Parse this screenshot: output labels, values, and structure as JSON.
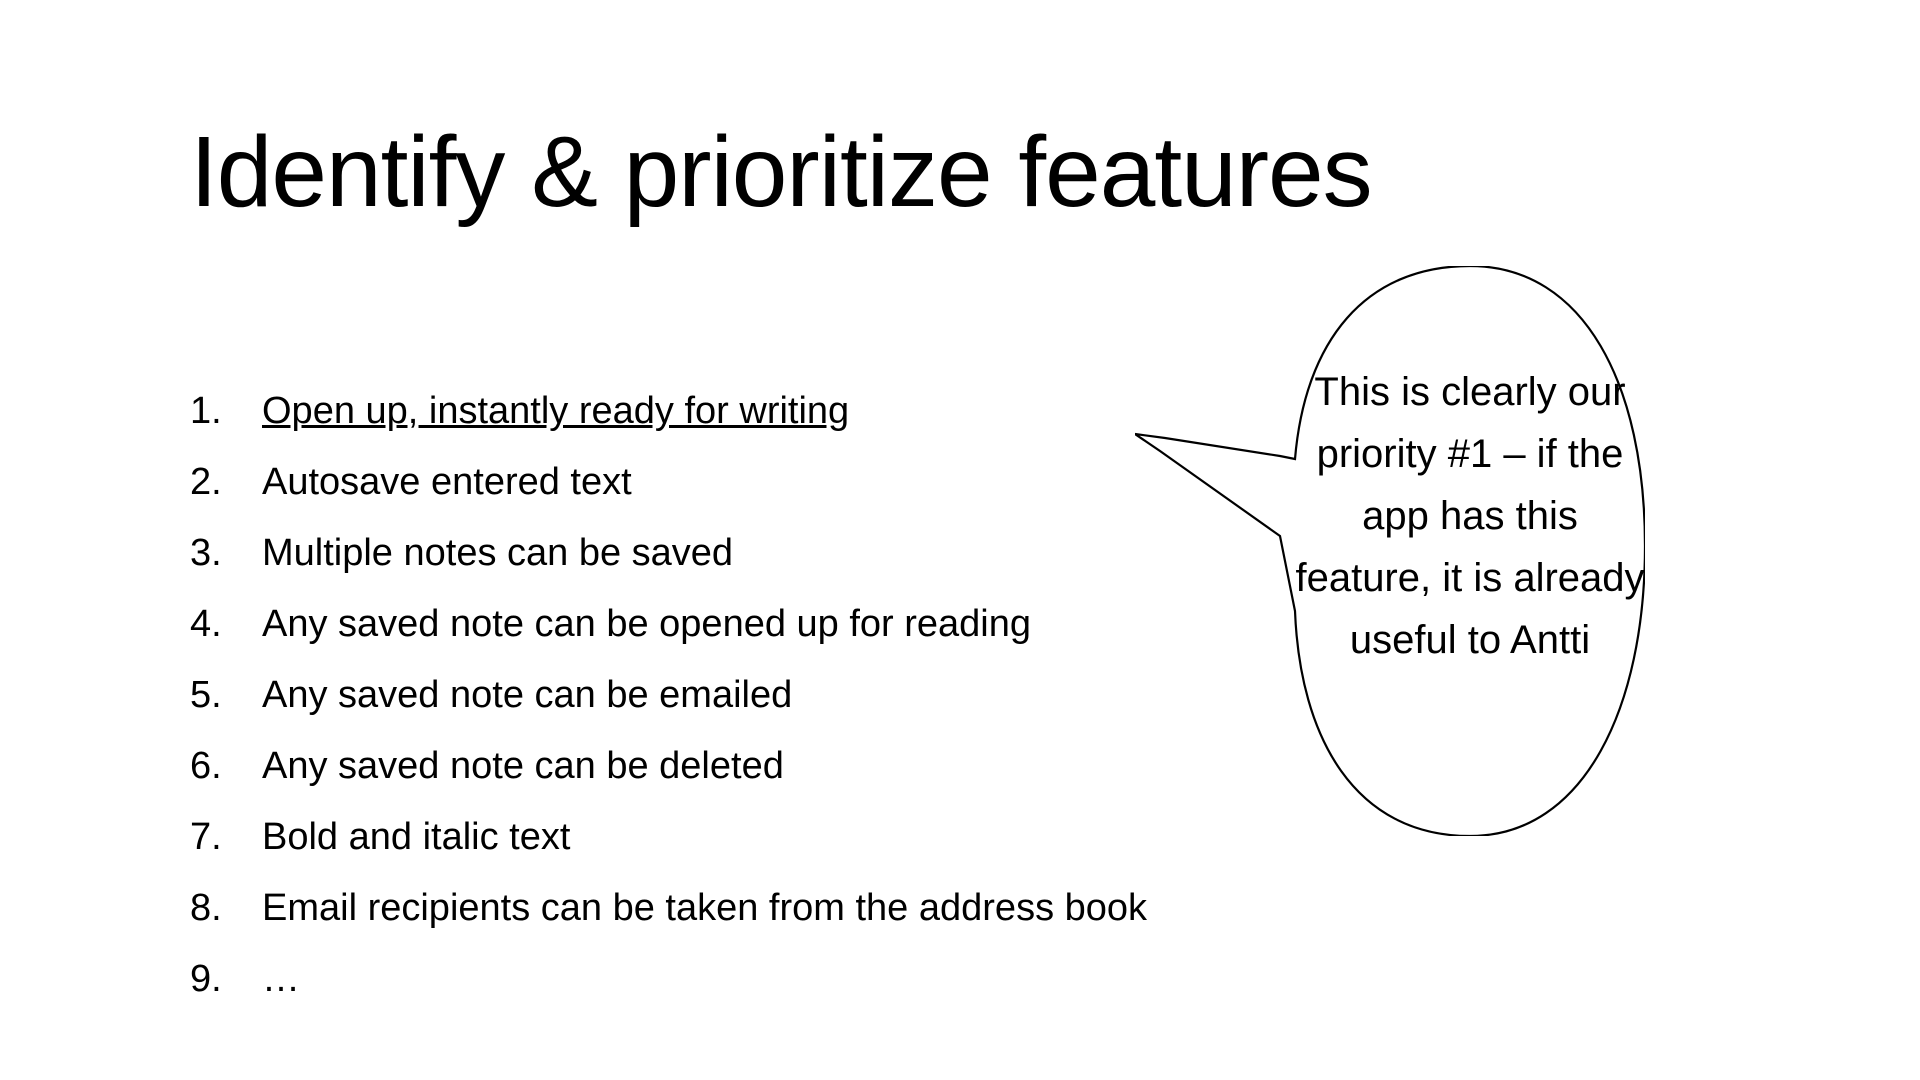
{
  "title": "Identify & prioritize features",
  "features": [
    "Open up, instantly ready for writing",
    "Autosave entered text",
    "Multiple notes can be saved",
    "Any saved note can be opened up for reading",
    "Any saved note can be emailed",
    "Any saved note can be deleted",
    "Bold and italic text",
    "Email recipients can be taken from the address book",
    "…"
  ],
  "callout": "This is clearly our priority #1 – if the app has this feature, it is already useful to Antti"
}
